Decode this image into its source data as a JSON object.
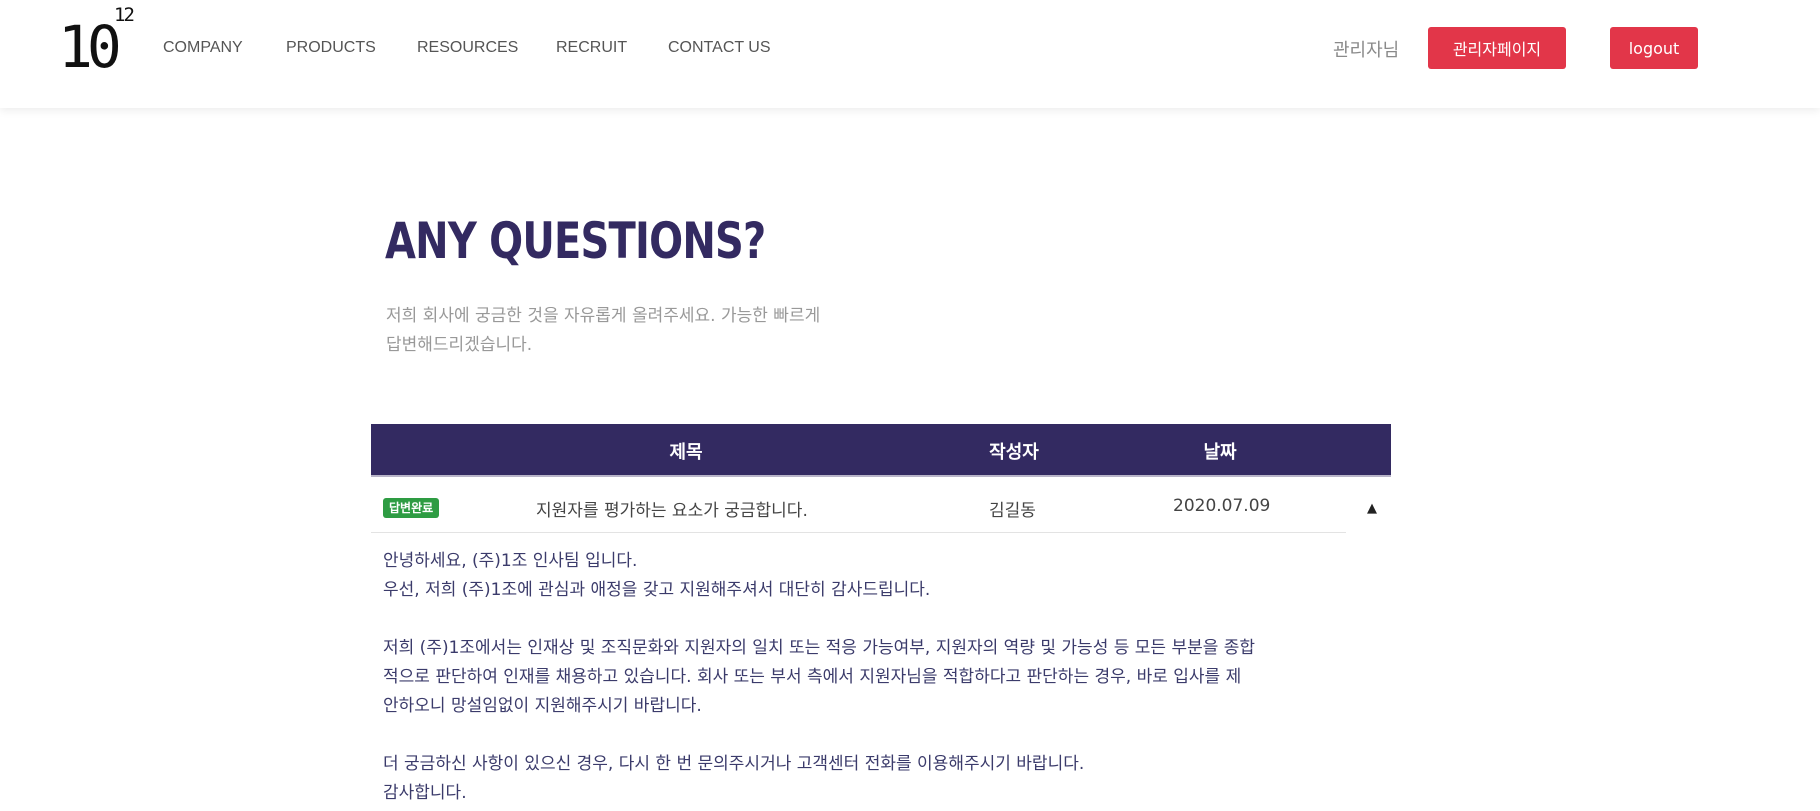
{
  "header": {
    "logo_main": "10",
    "logo_sup": "12",
    "nav": [
      "COMPANY",
      "PRODUCTS",
      "RESOURCES",
      "RECRUIT",
      "CONTACT US"
    ],
    "admin_name": "관리자님",
    "admin_page_label": "관리자페이지",
    "logout_label": "logout"
  },
  "main": {
    "title": "ANY QUESTIONS?",
    "subtitle_line1": "저희 회사에 궁금한 것을 자유롭게 올려주세요. 가능한 빠르게",
    "subtitle_line2": "답변해드리겠습니다."
  },
  "table": {
    "headers": {
      "title": "제목",
      "author": "작성자",
      "date": "날짜"
    },
    "rows": [
      {
        "badge": "답변완료",
        "title": "지원자를 평가하는 요소가 궁금합니다.",
        "author": "김길동",
        "date": "2020.07.09",
        "toggle": "▲"
      }
    ]
  },
  "answer": {
    "line1": "안녕하세요, (주)1조 인사팀 입니다.",
    "line2": "우선, 저희 (주)1조에 관심과 애정을 갖고 지원해주셔서 대단히 감사드립니다.",
    "para2_line1": "저희 (주)1조에서는 인재상 및 조직문화와 지원자의 일치 또는 적응 가능여부, 지원자의 역량 및 가능성 등 모든 부분을 종합",
    "para2_line2": "적으로 판단하여 인재를 채용하고 있습니다. 회사 또는 부서 측에서 지원자님을 적합하다고 판단하는 경우, 바로 입사를 제",
    "para2_line3": "안하오니 망설임없이 지원해주시기 바랍니다.",
    "para3_line1": "더 궁금하신 사항이 있으신 경우, 다시 한 번 문의주시거나 고객센터 전화를 이용해주시기 바랍니다.",
    "para3_line2": "감사합니다."
  },
  "colors": {
    "brand_navy": "#332a61",
    "button_red": "#e23649",
    "badge_green": "#2e9c43"
  }
}
